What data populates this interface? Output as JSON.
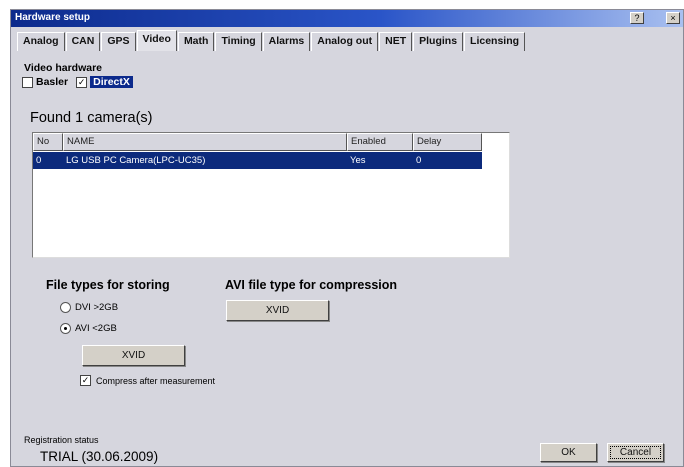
{
  "window": {
    "title": "Hardware setup",
    "help_icon": "help-icon",
    "close_icon": "close-icon"
  },
  "tabs": [
    {
      "label": "Analog"
    },
    {
      "label": "CAN"
    },
    {
      "label": "GPS"
    },
    {
      "label": "Video",
      "active": true
    },
    {
      "label": "Math"
    },
    {
      "label": "Timing"
    },
    {
      "label": "Alarms"
    },
    {
      "label": "Analog out"
    },
    {
      "label": "NET"
    },
    {
      "label": "Plugins"
    },
    {
      "label": "Licensing"
    }
  ],
  "video_hardware": {
    "label": "Video hardware",
    "basler": {
      "label": "Basler",
      "checked": false
    },
    "directx": {
      "label": "DirectX",
      "checked": true
    }
  },
  "cameras": {
    "found_label": "Found 1 camera(s)",
    "columns": [
      "No",
      "NAME",
      "Enabled",
      "Delay"
    ],
    "rows": [
      [
        "0",
        "LG USB PC Camera(LPC-UC35)",
        "Yes",
        "0"
      ]
    ]
  },
  "file_types": {
    "label": "File types for storing",
    "dvi": {
      "label": "DVI >2GB",
      "selected": false
    },
    "avi": {
      "label": "AVI <2GB",
      "selected": true
    },
    "codec_button": "XVID",
    "compress": {
      "label": "Compress after measurement",
      "checked": true
    }
  },
  "avi_compression": {
    "label": "AVI file type for compression",
    "codec_button": "XVID"
  },
  "registration": {
    "label": "Registration status",
    "value": "TRIAL (30.06.2009)"
  },
  "buttons": {
    "ok": "OK",
    "cancel": "Cancel"
  }
}
